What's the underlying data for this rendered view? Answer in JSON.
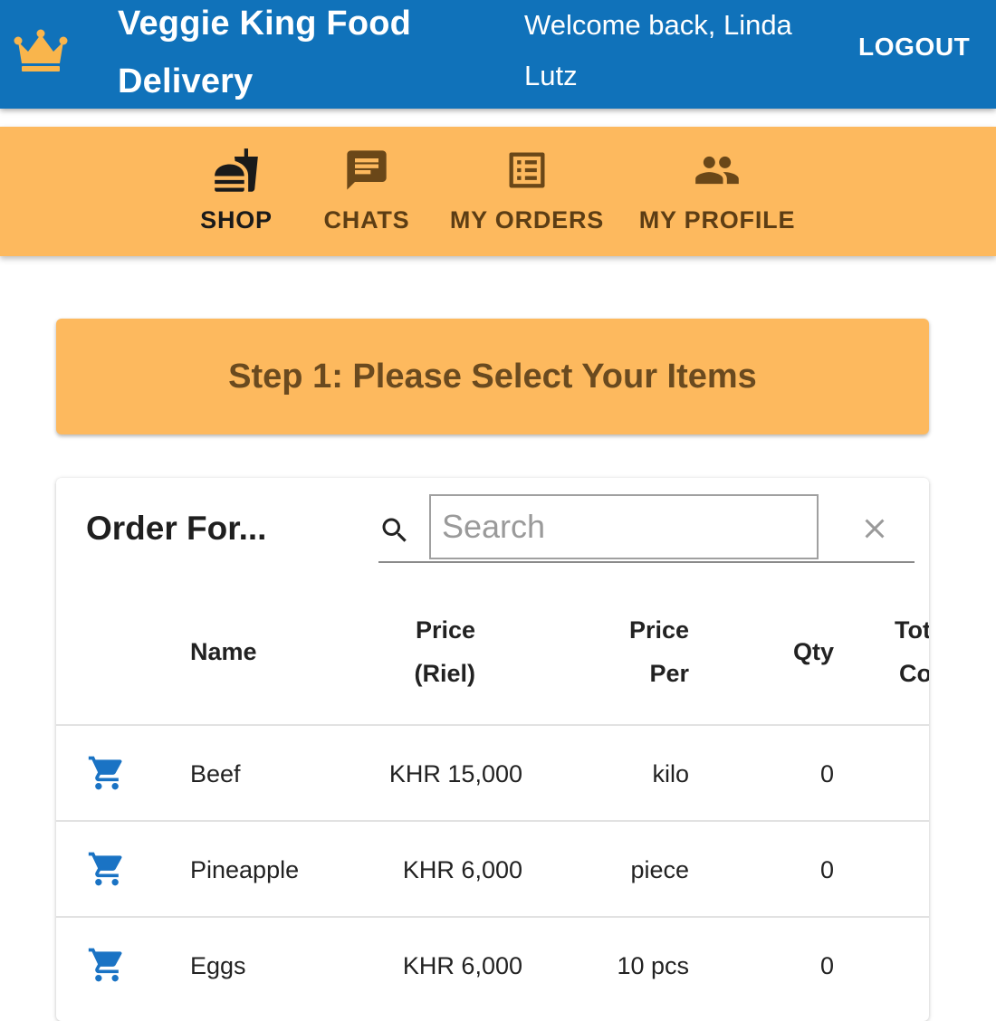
{
  "header": {
    "app_title_line1": "Veggie King Food",
    "app_title_line2": "Delivery",
    "welcome_line1": "Welcome back, Linda",
    "welcome_line2": "Lutz",
    "logout_label": "LOGOUT",
    "logo_icon": "crown-icon",
    "bg_color": "#1072ba",
    "crown_color": "#f9b54c"
  },
  "nav": {
    "bg_color": "#fdb95e",
    "items": [
      {
        "label": "SHOP",
        "icon": "fastfood-icon",
        "active": true
      },
      {
        "label": "CHATS",
        "icon": "chat-icon",
        "active": false
      },
      {
        "label": "MY ORDERS",
        "icon": "list-icon",
        "active": false
      },
      {
        "label": "MY PROFILE",
        "icon": "people-icon",
        "active": false
      }
    ]
  },
  "step_banner": "Step 1: Please Select Your Items",
  "order_form": {
    "title": "Order For...",
    "search_placeholder": "Search",
    "search_value": "",
    "columns": [
      {
        "line1": "Name",
        "line2": ""
      },
      {
        "line1": "Price",
        "line2": "(Riel)"
      },
      {
        "line1": "Price",
        "line2": "Per"
      },
      {
        "line1": "Qty",
        "line2": ""
      },
      {
        "line1": "Tot",
        "line2": "Co"
      }
    ],
    "rows": [
      {
        "name": "Beef",
        "price": "KHR 15,000",
        "per": "kilo",
        "qty": "0"
      },
      {
        "name": "Pineapple",
        "price": "KHR 6,000",
        "per": "piece",
        "qty": "0"
      },
      {
        "name": "Eggs",
        "price": "KHR 6,000",
        "per": "10 pcs",
        "qty": "0"
      }
    ],
    "cart_icon_color": "#1a73c4"
  }
}
